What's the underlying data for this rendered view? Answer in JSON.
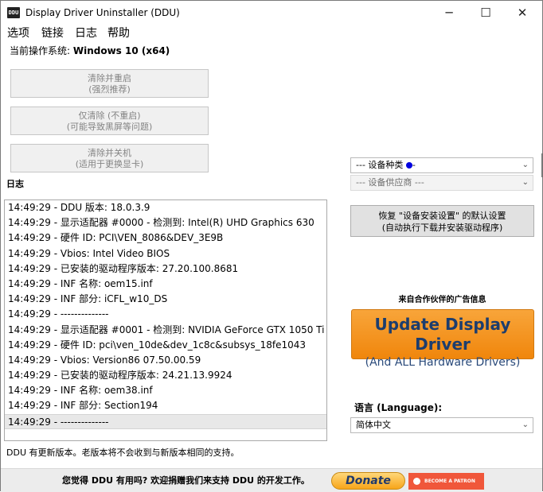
{
  "window": {
    "icon_text": "DDU",
    "title": "Display Driver Uninstaller (DDU)",
    "controls": {
      "minimize": "─",
      "maximize": "☐",
      "close": "✕"
    }
  },
  "menu": [
    "选项",
    "链接",
    "日志",
    "帮助"
  ],
  "os": {
    "label": "当前操作系统: ",
    "value": "Windows 10 (x64)"
  },
  "actions": [
    {
      "line1": "清除并重启",
      "line2": "(强烈推荐)"
    },
    {
      "line1": "仅清除 (不重启)",
      "line2": "(可能导致黑屏等问题)"
    },
    {
      "line1": "清除并关机",
      "line2": "(适用于更换显卡)"
    }
  ],
  "log": {
    "label": "日志",
    "lines": [
      "14:49:29 - DDU 版本: 18.0.3.9",
      "14:49:29 - 显示适配器 #0000 - 检测到: Intel(R) UHD Graphics 630",
      "14:49:29 - 硬件 ID: PCI\\VEN_8086&DEV_3E9B",
      "14:49:29 - Vbios: Intel Video BIOS",
      "14:49:29 - 已安装的驱动程序版本: 27.20.100.8681",
      "14:49:29 - INF 名称: oem15.inf",
      "14:49:29 - INF 部分: iCFL_w10_DS",
      "14:49:29 - --------------",
      "14:49:29 - 显示适配器 #0001 - 检测到: NVIDIA GeForce GTX 1050 Ti",
      "14:49:29 - 硬件 ID: pci\\ven_10de&dev_1c8c&subsys_18fe1043",
      "14:49:29 - Vbios: Version86 07.50.00.59",
      "14:49:29 - 已安装的驱动程序版本: 24.21.13.9924",
      "14:49:29 - INF 名称: oem38.inf",
      "14:49:29 - INF 部分: Section194",
      "14:49:29 - --------------"
    ]
  },
  "status": "DDU 有更新版本。老版本将不会收到与新版本相同的支持。",
  "device_type": {
    "value": "--- 设备种类 ---"
  },
  "device_vendor": {
    "value": "--- 设备供应商 ---"
  },
  "restore": {
    "line1": "恢复 \"设备安装设置\" 的默认设置",
    "line2": "(自动执行下载并安装驱动程序)"
  },
  "partner_label": "来自合作伙伴的广告信息",
  "ad": {
    "line1": "Update Display Driver",
    "line2": "(And ALL Hardware Drivers)"
  },
  "language": {
    "label": "语言 (Language):",
    "value": "简体中文"
  },
  "footer": {
    "text": "您觉得 DDU 有用吗? 欢迎捐赠我们来支持 DDU 的开发工作。",
    "donate": "Donate",
    "patron": "BECOME A PATRON"
  },
  "icons": {
    "chevron": "chevron-down-icon"
  },
  "colors": {
    "ad_orange": "#f0860c",
    "ad_text": "#1c3d6e",
    "patron_red": "#f0573b"
  }
}
